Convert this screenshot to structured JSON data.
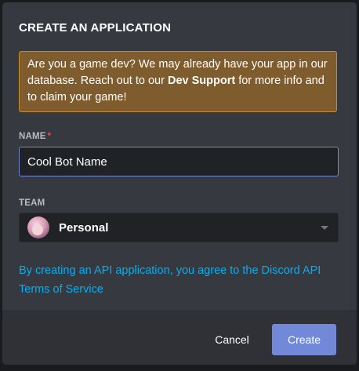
{
  "modal": {
    "title": "CREATE AN APPLICATION",
    "notice": {
      "text_before": "Are you a game dev? We may already have your app in our database. Reach out to our ",
      "bold": "Dev Support",
      "text_after": " for more info and to claim your game!"
    },
    "name_field": {
      "label": "NAME",
      "required_marker": "*",
      "value": "Cool Bot Name"
    },
    "team_field": {
      "label": "TEAM",
      "value": "Personal"
    },
    "tos_text": "By creating an API application, you agree to the Discord API Terms of Service",
    "cancel_label": "Cancel",
    "create_label": "Create"
  },
  "colors": {
    "accent": "#7289da",
    "notice_bg": "#7f5c2e",
    "notice_border": "#c9892f",
    "link": "#00b0f4",
    "required": "#f04747"
  }
}
